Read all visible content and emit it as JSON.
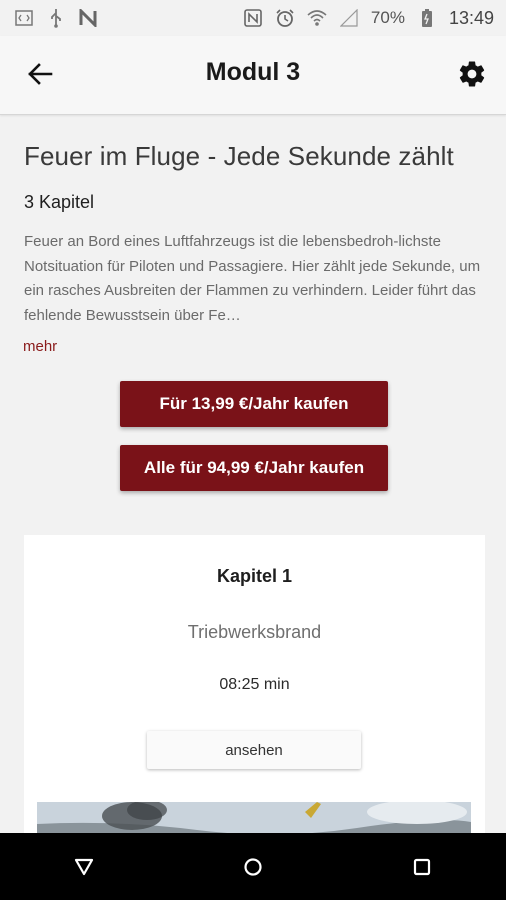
{
  "status_bar": {
    "left_icons": [
      "code-icon",
      "usb-icon",
      "notification-n-icon"
    ],
    "right_icons": [
      "nfc-icon",
      "alarm-icon",
      "wifi-icon",
      "signal-icon"
    ],
    "battery": "70%",
    "time": "13:49"
  },
  "toolbar": {
    "title": "Modul 3",
    "back_icon": "arrow-back-icon",
    "settings_icon": "gear-icon"
  },
  "module": {
    "title": "Feuer im Fluge - Jede Sekunde zählt",
    "chapters": "3 Kapitel",
    "description": "Feuer an Bord eines Luftfahrzeugs ist die lebensbedroh-lichste Notsituation für Piloten und Passagiere. Hier zählt jede Sekunde, um ein rasches Ausbreiten der Flammen zu verhindern. Leider führt das fehlende Bewusstsein über Fe…",
    "more_label": "mehr"
  },
  "buy": {
    "single_label": "Für 13,99 €/Jahr kaufen",
    "all_label": "Alle für 94,99 €/Jahr kaufen"
  },
  "chapter_card": {
    "title": "Kapitel 1",
    "subtitle": "Triebwerksbrand",
    "duration": "08:25 min",
    "watch_label": "ansehen"
  },
  "colors": {
    "accent": "#7a1218",
    "link": "#8a1b1b",
    "background": "#f2f2f2"
  },
  "nav_bar": {
    "icons": [
      "nav-back-icon",
      "nav-home-icon",
      "nav-recents-icon"
    ]
  }
}
